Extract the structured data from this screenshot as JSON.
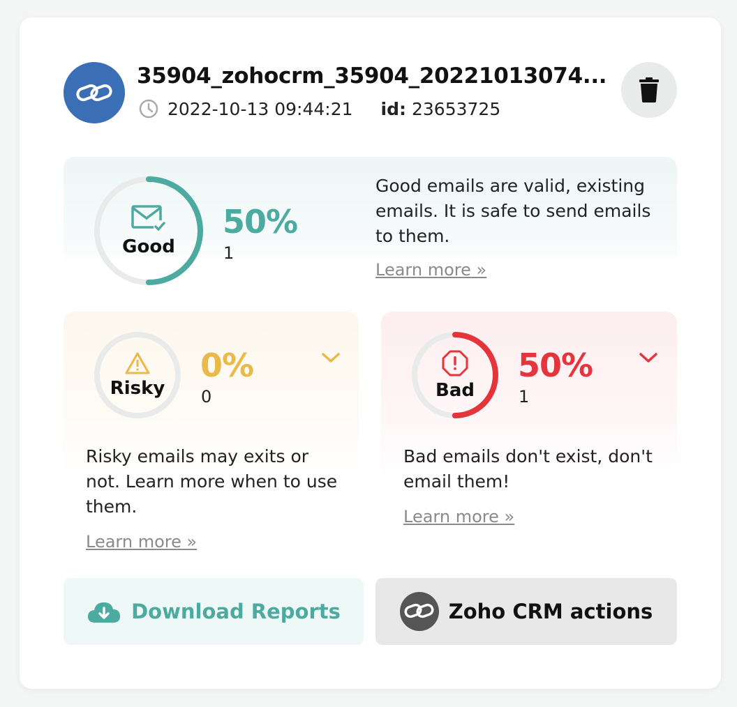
{
  "header": {
    "title": "35904_zohocrm_35904_20221013074...",
    "timestamp": "2022-10-13 09:44:21",
    "id_label": "id:",
    "id_value": "23653725"
  },
  "good": {
    "label": "Good",
    "percent": "50%",
    "count": "1",
    "fraction": 0.5,
    "color": "#4daaa0",
    "desc": [
      "Good emails are valid, existing",
      "emails. It is safe to send emails",
      "to them."
    ],
    "learn_more": "Learn more »"
  },
  "risky": {
    "label": "Risky",
    "percent": "0%",
    "count": "0",
    "fraction": 0,
    "color": "#e9b949",
    "desc": [
      "Risky emails may exits or",
      "not. Learn more when to use",
      "them."
    ],
    "learn_more": "Learn more »"
  },
  "bad": {
    "label": "Bad",
    "percent": "50%",
    "count": "1",
    "fraction": 0.5,
    "color": "#e4343c",
    "desc": [
      "Bad emails don't exist, don't",
      "email them!"
    ],
    "learn_more": "Learn more »"
  },
  "actions": {
    "download_label": "Download Reports",
    "crm_label": "Zoho CRM actions"
  },
  "icons": {
    "logo": "zoho-link-icon",
    "clock": "clock-icon",
    "trash": "trash-icon",
    "good": "envelope-check-icon",
    "risky": "warning-triangle-icon",
    "bad": "stop-exclamation-icon",
    "download": "cloud-download-icon",
    "crm": "zoho-link-icon"
  }
}
